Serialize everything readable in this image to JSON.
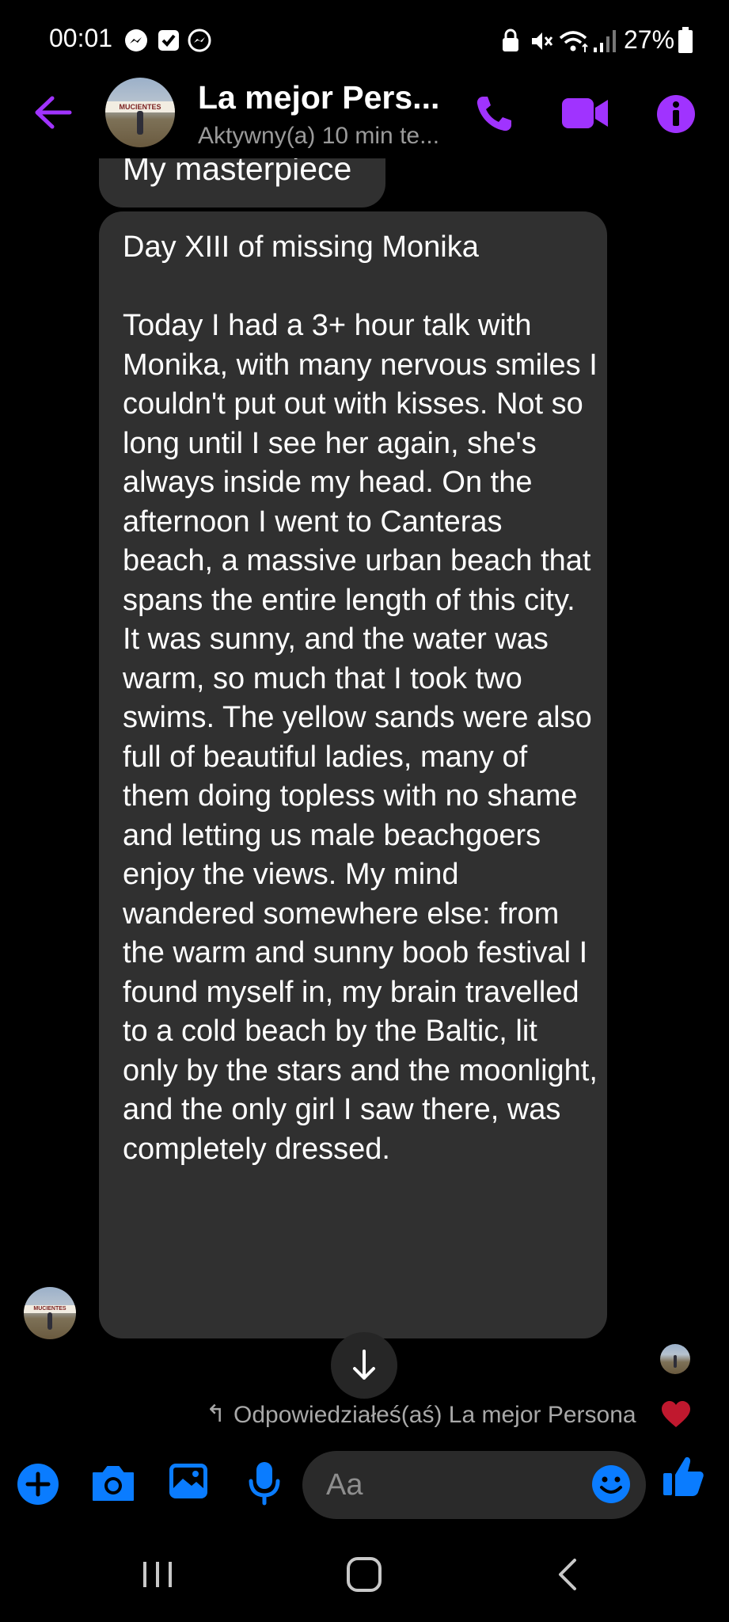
{
  "status_bar": {
    "time": "00:01",
    "battery_percent": "27%"
  },
  "header": {
    "contact_name": "La mejor Pers...",
    "contact_status": "Aktywny(a) 10 min te...",
    "avatar_sign_text": "MUCIENTES"
  },
  "messages": {
    "top_fragment": "My masterpiece",
    "main": "Day XIII of missing Monika\n\nToday I had a 3+ hour talk with Monika, with many nervous smiles I couldn't put out with kisses. Not so long until I see her again, she's always inside my head. On the afternoon I went to Canteras beach, a massive urban beach that spans the entire length of this city. It was sunny, and the water was warm, so much that I took two swims. The yellow sands were also full of beautiful ladies, many of them doing topless with no shame and letting us male beachgoers enjoy the views. My mind wandered somewhere else: from the warm and sunny boob festival I found myself in, my brain travelled to a cold beach by the Baltic, lit only by the stars and the moonlight, and the only girl I saw there, was completely dressed."
  },
  "reply_notice": {
    "text": "Odpowiedziałeś(aś) La mejor Persona",
    "reaction_icon": "heart-icon"
  },
  "composer": {
    "placeholder": "Aa"
  },
  "colors": {
    "accent_purple": "#a033ff",
    "accent_blue": "#0a7cff",
    "bubble": "#303030",
    "background": "#000000"
  }
}
